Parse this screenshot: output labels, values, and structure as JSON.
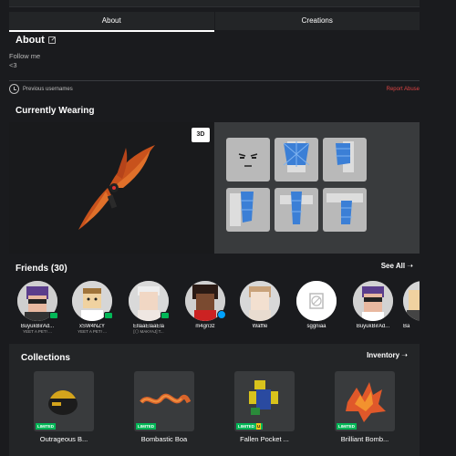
{
  "tabs": [
    {
      "label": "About"
    },
    {
      "label": "Creations"
    }
  ],
  "about": {
    "title": "About",
    "bio_line1": "Follow me",
    "bio_line2": "<3",
    "previous_usernames": "Previous usernames",
    "report_abuse": "Report Abuse"
  },
  "wearing": {
    "title": "Currently Wearing",
    "toggle_3d": "3D"
  },
  "friends": {
    "title": "Friends (30)",
    "see_all": "See All ➝",
    "items": [
      {
        "name": "BuyukBirAd...",
        "status": "YEET A PET! ..."
      },
      {
        "name": "xSW4NZY",
        "status": "YEET A PET! ..."
      },
      {
        "name": "EllaaElaaEla",
        "status": "[🌕 MAKYAJ] T..."
      },
      {
        "name": "m4gn3z",
        "status": ""
      },
      {
        "name": "Waffle",
        "status": ""
      },
      {
        "name": "sggniaa",
        "status": ""
      },
      {
        "name": "BuyukBirAd...",
        "status": ""
      },
      {
        "name": "Ba",
        "status": ""
      }
    ]
  },
  "collections": {
    "title": "Collections",
    "inventory": "Inventory ➝",
    "items": [
      {
        "label": "Outrageous B...",
        "tag": "LIMITED"
      },
      {
        "label": "Bombastic Boa",
        "tag": "LIMITED"
      },
      {
        "label": "Fallen Pocket ...",
        "tag": "LIMITED"
      },
      {
        "label": "Brilliant Bomb...",
        "tag": "LIMITED"
      }
    ]
  }
}
